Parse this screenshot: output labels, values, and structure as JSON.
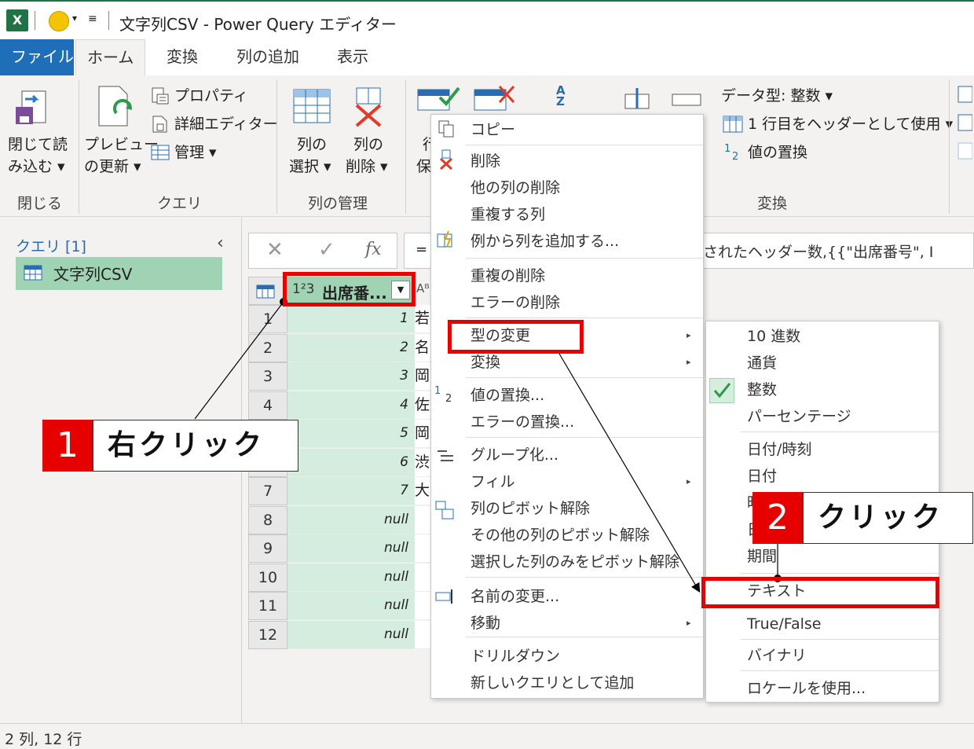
{
  "window": {
    "title": "文字列CSV - Power Query エディター"
  },
  "tabs": [
    "ファイル",
    "ホーム",
    "変換",
    "列の追加",
    "表示"
  ],
  "ribbon": {
    "close_load_label_1": "閉じて読",
    "close_load_label_2": "み込む ▾",
    "preview_label_1": "プレビュー",
    "preview_label_2": "の更新 ▾",
    "properties": "プロパティ",
    "advanced_editor": "詳細エディター",
    "manage": "管理 ▾",
    "select_columns_1": "列の",
    "select_columns_2": "選択 ▾",
    "remove_columns_1": "列の",
    "remove_columns_2": "削除 ▾",
    "keep_rows_1": "行",
    "keep_rows_2": "保",
    "data_type": "データ型: 整数 ▾",
    "use_first_row": "1 行目をヘッダーとして使用 ▾",
    "replace_values": "値の置換",
    "groups": {
      "close": "閉じる",
      "query": "クエリ",
      "manage_columns": "列の管理",
      "transform": "変換"
    }
  },
  "query_pane": {
    "header": "クエリ [1]",
    "items": [
      "文字列CSV"
    ]
  },
  "formula_bar": {
    "fx": "fx",
    "eq": "=",
    "visible_text": "されたヘッダー数,{{\"出席番号\", I"
  },
  "grid": {
    "col1_type": "1²3",
    "col1_header": "出席番...",
    "col2_type": "Aᴮ",
    "row_numbers": [
      "1",
      "2",
      "3",
      "4",
      "5",
      "6",
      "7",
      "8",
      "9",
      "10",
      "11",
      "12"
    ],
    "col1_values": [
      "1",
      "2",
      "3",
      "4",
      "5",
      "6",
      "7",
      "null",
      "null",
      "null",
      "null",
      "null"
    ],
    "col2_values": [
      "若",
      "名",
      "岡",
      "佐",
      "岡",
      "渋",
      "大",
      "",
      "",
      "",
      "",
      ""
    ]
  },
  "context_menu": {
    "items": [
      "コピー",
      "削除",
      "他の列の削除",
      "重複する列",
      "例から列を追加する...",
      "重複の削除",
      "エラーの削除",
      "型の変更",
      "変換",
      "値の置換...",
      "エラーの置換...",
      "グループ化...",
      "フィル",
      "列のピボット解除",
      "その他の列のピボット解除",
      "選択した列のみをピボット解除",
      "名前の変更...",
      "移動",
      "ドリルダウン",
      "新しいクエリとして追加"
    ]
  },
  "type_submenu": {
    "items": [
      "10 進数",
      "通貨",
      "整数",
      "パーセンテージ",
      "日付/時刻",
      "日付",
      "時",
      "日",
      "期間",
      "テキスト",
      "True/False",
      "バイナリ",
      "ロケールを使用..."
    ]
  },
  "callouts": [
    {
      "number": "1",
      "text": "右クリック"
    },
    {
      "number": "2",
      "text": "クリック"
    }
  ],
  "status": {
    "text": "2 列, 12 行"
  },
  "colors": {
    "accent": "#1f6fb8",
    "excel_green": "#217346",
    "highlight_red": "#e60000",
    "selected_column": "#d5eddf"
  }
}
